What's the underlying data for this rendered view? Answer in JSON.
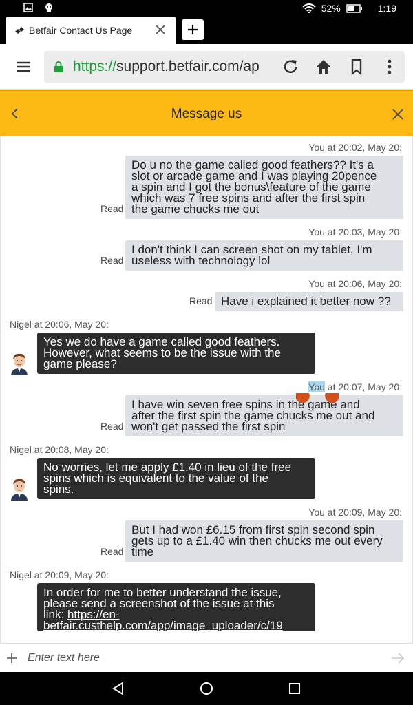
{
  "status_bar": {
    "battery": "52%",
    "time": "1:19"
  },
  "browser": {
    "tab_title": "Betfair Contact Us Page",
    "url_scheme": "https://",
    "url_rest": "support.betfair.com/ap"
  },
  "chat": {
    "header_title": "Message us",
    "input_placeholder": "Enter text here",
    "messages": [
      {
        "meta": "You at 20:02, May 20:",
        "status": "Read",
        "lines": [
          "Do u no the game called good feathers?? It's a",
          "slot or arcade game and I was playing 20pence",
          "a spin and I got the bonus\\feature of the game",
          "which was 7 free spins and after the first spin",
          "the game chucks me out"
        ]
      },
      {
        "meta": "You at 20:03, May 20:",
        "status": "Read",
        "lines": [
          "I don't think I can screen shot on my tablet, I'm",
          "useless with technology lol"
        ]
      },
      {
        "meta": "You at 20:06, May 20:",
        "status": "Read",
        "lines": [
          "Have i explained it better now ??"
        ]
      },
      {
        "meta": "Nigel at 20:06, May 20:",
        "lines": [
          "Yes we do have a game called good feathers.",
          "However, what seems to be the issue with the",
          "game please?"
        ]
      },
      {
        "meta_you": "You",
        "meta_rest": " at 20:07, May 20:",
        "status": "Read",
        "lines": [
          "I have win seven free spins in the game and",
          "after the first spin the game chucks me out and",
          "won't get passed the first spin"
        ]
      },
      {
        "meta": "Nigel at 20:08, May 20:",
        "lines": [
          "No worries, let me apply £1.40 in lieu of the free",
          "spins which is equivalent to the value of the",
          "spins."
        ]
      },
      {
        "meta": "You at 20:09, May 20:",
        "status": "Read",
        "lines": [
          "But I had won £6.15 from first spin second spin",
          "gets up to a £1.40 win then chucks me out every",
          "time"
        ]
      },
      {
        "meta": "Nigel at 20:09, May 20:",
        "lines": [
          "In order for me to better understand the issue,",
          "please send a screenshot of the issue at this"
        ],
        "link_prefix": "link: ",
        "link_line1": "https://en-",
        "link_line2": "betfair.custhelp.com/app/image_uploader/c/19"
      }
    ]
  }
}
